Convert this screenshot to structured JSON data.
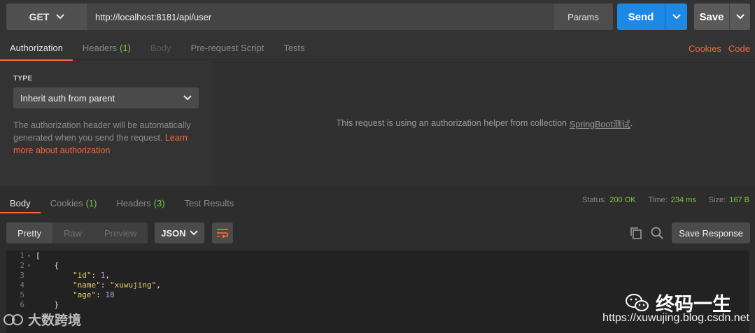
{
  "request": {
    "method": "GET",
    "url": "http://localhost:8181/api/user",
    "params_label": "Params",
    "send_label": "Send",
    "save_label": "Save"
  },
  "request_tabs": [
    {
      "label": "Authorization",
      "count": ""
    },
    {
      "label": "Headers",
      "count": "(1)"
    },
    {
      "label": "Body",
      "count": ""
    },
    {
      "label": "Pre-request Script",
      "count": ""
    },
    {
      "label": "Tests",
      "count": ""
    }
  ],
  "right_links": {
    "cookies": "Cookies",
    "code": "Code"
  },
  "auth": {
    "type_label": "TYPE",
    "selected_type": "Inherit auth from parent",
    "help_text": "The authorization header will be automatically generated when you send the request.",
    "help_link": "Learn more about authorization",
    "main_message": "This request is using an authorization helper from collection",
    "collection_name": "SpringBoot测试",
    "main_message_end": "."
  },
  "response_tabs": [
    {
      "label": "Body",
      "count": ""
    },
    {
      "label": "Cookies",
      "count": "(1)"
    },
    {
      "label": "Headers",
      "count": "(3)"
    },
    {
      "label": "Test Results",
      "count": ""
    }
  ],
  "status": {
    "status_label": "Status:",
    "status_value": "200 OK",
    "time_label": "Time:",
    "time_value": "234 ms",
    "size_label": "Size:",
    "size_value": "167 B"
  },
  "view_modes": [
    "Pretty",
    "Raw",
    "Preview"
  ],
  "format": "JSON",
  "save_response_label": "Save Response",
  "code_lines": [
    {
      "n": "1",
      "fold": "▾"
    },
    {
      "n": "2",
      "fold": "▾"
    },
    {
      "n": "3",
      "fold": ""
    },
    {
      "n": "4",
      "fold": ""
    },
    {
      "n": "5",
      "fold": ""
    },
    {
      "n": "6",
      "fold": ""
    }
  ],
  "json_body": {
    "key_id": "\"id\"",
    "val_id": "1",
    "key_name": "\"name\"",
    "val_name": "\"xuwujing\"",
    "key_age": "\"age\"",
    "val_age": "18"
  },
  "watermark": {
    "left_text": "大数跨境",
    "cn_text": "终码一生",
    "url": "https://xuwujing.blog.csdn.net"
  },
  "colors": {
    "accent": "#f26b3a",
    "send": "#1e88e5",
    "ok": "#7ac943"
  }
}
